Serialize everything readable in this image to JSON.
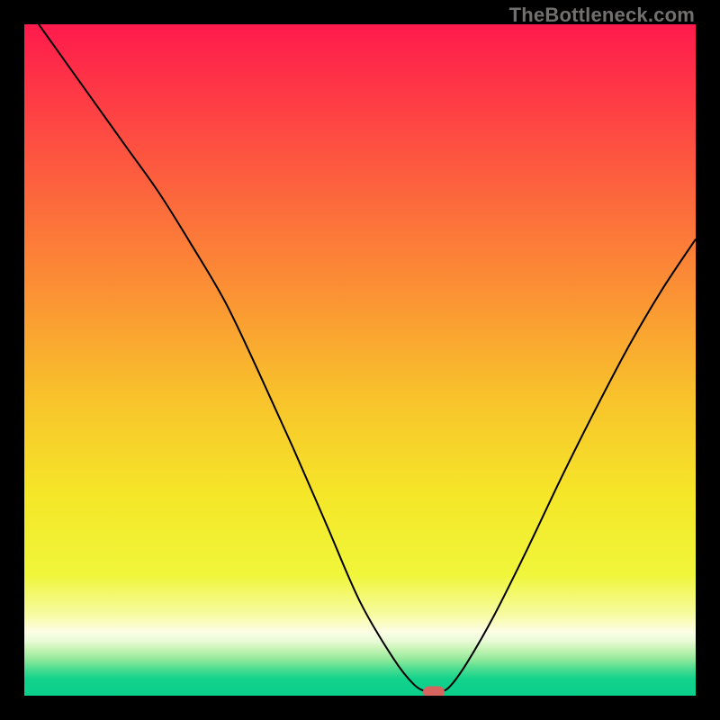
{
  "attribution": {
    "text": "TheBottleneck.com"
  },
  "chart_data": {
    "type": "line",
    "title": "",
    "xlabel": "",
    "ylabel": "",
    "xlim": [
      0,
      100
    ],
    "ylim": [
      0,
      100
    ],
    "legend": false,
    "grid": false,
    "background": {
      "type": "vertical-gradient",
      "stops": [
        {
          "pos": 0.0,
          "color": "#ff1a4c"
        },
        {
          "pos": 0.2,
          "color": "#fd5640"
        },
        {
          "pos": 0.4,
          "color": "#fb9234"
        },
        {
          "pos": 0.55,
          "color": "#f8c12c"
        },
        {
          "pos": 0.7,
          "color": "#f5e628"
        },
        {
          "pos": 0.82,
          "color": "#f0f63a"
        },
        {
          "pos": 0.88,
          "color": "#f7fba3"
        },
        {
          "pos": 0.905,
          "color": "#fdfde6"
        },
        {
          "pos": 0.918,
          "color": "#eafbd8"
        },
        {
          "pos": 0.93,
          "color": "#c8f4b7"
        },
        {
          "pos": 0.945,
          "color": "#95ea9c"
        },
        {
          "pos": 0.96,
          "color": "#4cdd91"
        },
        {
          "pos": 0.975,
          "color": "#13d28c"
        },
        {
          "pos": 1.0,
          "color": "#09cf8c"
        }
      ]
    },
    "series": [
      {
        "name": "bottleneck-curve",
        "color": "#000000",
        "x": [
          0,
          5,
          10,
          15,
          20,
          25,
          30,
          35,
          40,
          45,
          50,
          55,
          58,
          60,
          62,
          63.5,
          66,
          70,
          75,
          80,
          85,
          90,
          95,
          100
        ],
        "y": [
          103,
          96,
          89,
          82,
          75,
          67,
          58.5,
          48,
          37,
          25.5,
          14,
          5.5,
          1.7,
          0.6,
          0.6,
          1.5,
          5,
          12,
          22,
          32.5,
          42.5,
          52,
          60.5,
          68
        ]
      }
    ],
    "min_marker": {
      "x": 61,
      "y": 0.6,
      "color": "#d66560",
      "shape": "rounded-pill"
    }
  }
}
